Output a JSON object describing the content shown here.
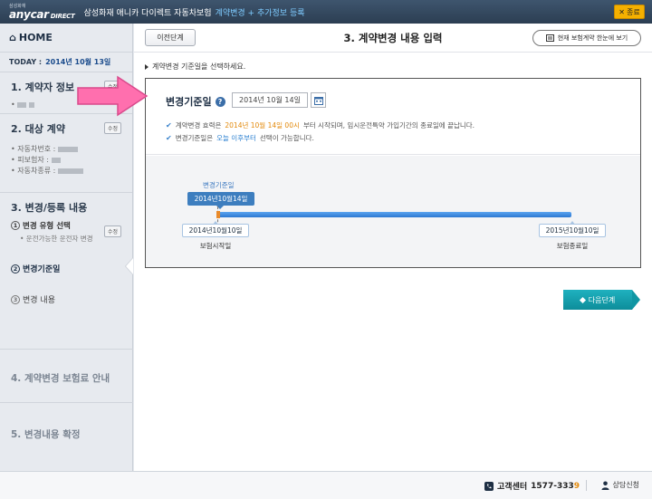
{
  "topbar": {
    "logo_sub": "삼성화재",
    "logo_main": "anycar",
    "logo_direct": "DIRECT",
    "title": "삼성화재 애니카 다이렉트 자동차보험",
    "steps": "계약변경 + 추가정보 등록",
    "close_label": "종료"
  },
  "sidebar": {
    "home": "HOME",
    "today_label": "TODAY :",
    "today_date": "2014년 10월 13일",
    "edit_label": "수정",
    "sec1_title": "1. 계약자 정보",
    "sec1_bullet": "•",
    "sec2_title": "2. 대상 계약",
    "sec2_rows": [
      "• 자동차번호 :",
      "• 피보험자 :",
      "• 자동차종류 :"
    ],
    "sec3_title": "3. 변경/등록 내용",
    "sec3_sub_num": "1",
    "sec3_sub_label": "변경 유형 선택",
    "sec3_sub_desc": "• 운전가능한 운전자 변경",
    "sec3_active_num": "2",
    "sec3_active_label": "변경기준일",
    "sec3_item3_num": "3",
    "sec3_item3_label": "변경 내용",
    "sec4_title": "4. 계약변경 보험료 안내",
    "sec5_title": "5. 변경내용 확정"
  },
  "main": {
    "back_label": "이전단계",
    "page_title": "3. 계약변경 내용 입력",
    "view_btn_label": "현재 보험계약 한눈에 보기",
    "instruction": "계약변경 기준일을 선택하세요.",
    "date_label": "변경기준일",
    "help_glyph": "?",
    "colon": ":",
    "date_value": "2014년 10월 14일",
    "info1_pre": "계약변경 효력은",
    "info1_hl": "2014년 10월 14일 00시",
    "info1_post": "부터 시작되며, 임시운전특약 가입기간의 종료일에 끝납니다.",
    "info2_pre": "변경기준일은",
    "info2_hl": "오늘 이후부터",
    "info2_post": "선택이 가능합니다.",
    "next_label": "다음단계"
  },
  "timeline": {
    "change_label": "변경기준일",
    "change_date": "2014년10월14일",
    "start_date": "2014년10월10일",
    "start_label": "보험시작일",
    "end_date": "2015년10월10일",
    "end_label": "보험종료일"
  },
  "footer": {
    "callcenter_label": "고객센터",
    "phone_main": "1577-333",
    "phone_last": "9",
    "consult_label": "상담신청"
  },
  "colors": {
    "annotation_arrow": "#ff6fae",
    "accent_teal": "#12a0ad",
    "highlight_orange": "#e38a0c",
    "timeline_blue": "#3d7ebf"
  }
}
